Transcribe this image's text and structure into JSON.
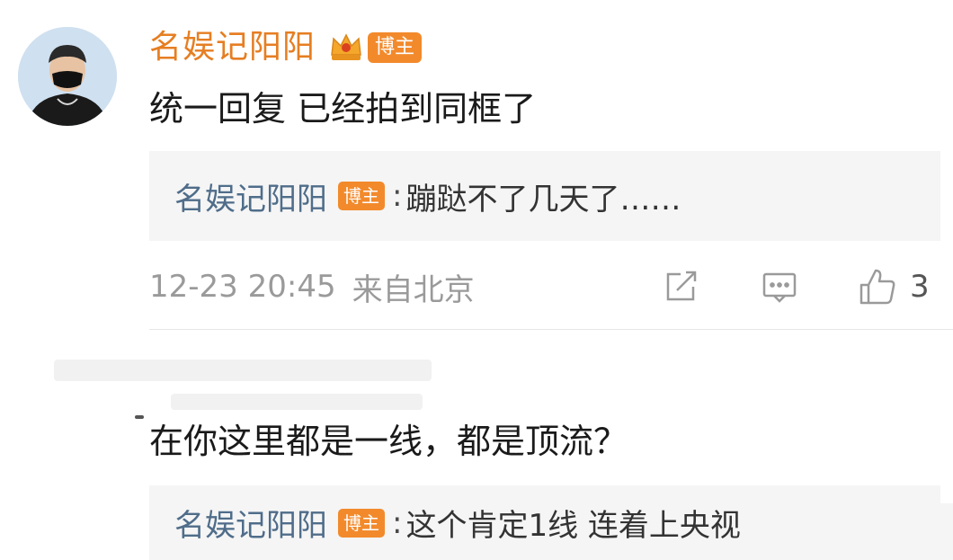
{
  "comment1": {
    "author": "名娱记阳阳",
    "badge": "博主",
    "text": "统一回复 已经拍到同框了",
    "reply": {
      "author": "名娱记阳阳",
      "badge": "博主",
      "colon": ":",
      "content": "蹦跶不了几天了……"
    },
    "time": "12-23 20:45",
    "location": "来自北京",
    "like_count": "3"
  },
  "comment2": {
    "text": "在你这里都是一线，都是顶流？",
    "reply": {
      "author": "名娱记阳阳",
      "badge": "博主",
      "colon": ":",
      "content": "这个肯定1线 连着上央视"
    }
  },
  "colors": {
    "author_orange": "#e67e22",
    "badge_orange": "#f28a2c",
    "reply_author_blue": "#4f6d8a",
    "meta_gray": "#9a9a9a"
  },
  "icons": {
    "share": "share-icon",
    "comment": "comment-icon",
    "like": "thumbs-up-icon",
    "vip": "crown-icon"
  }
}
